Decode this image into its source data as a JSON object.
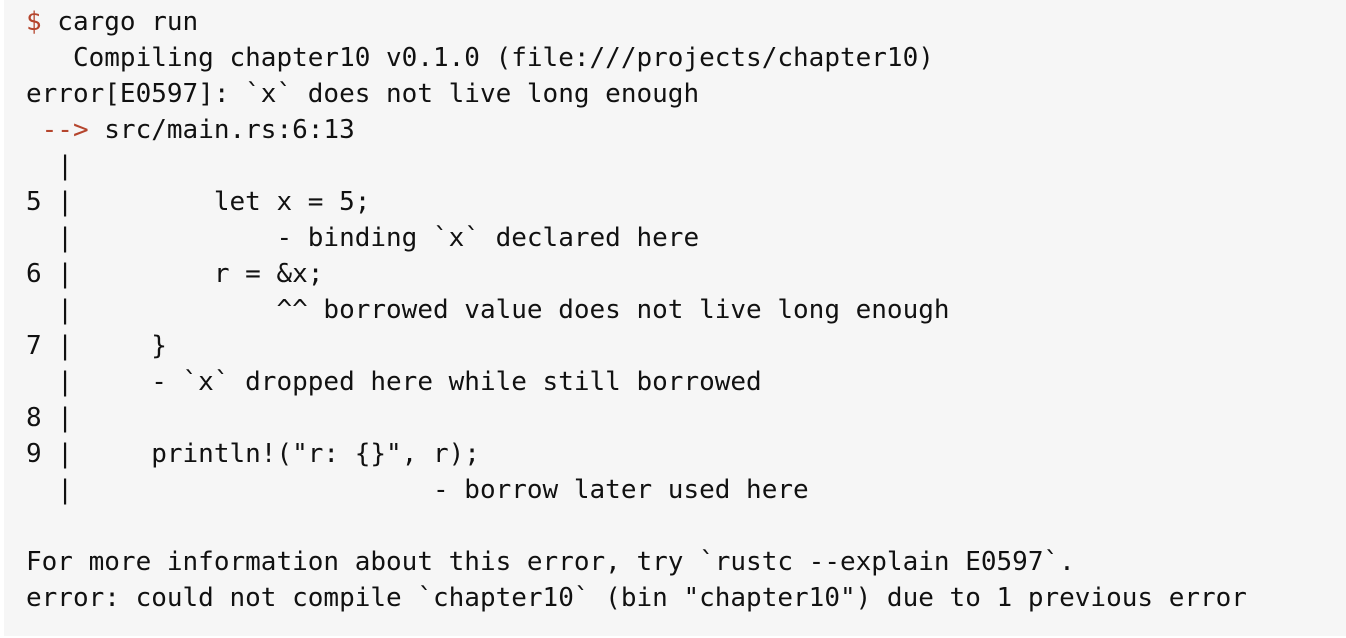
{
  "terminal": {
    "prompt_symbol": "$",
    "command": " cargo run",
    "lines": [
      "   Compiling chapter10 v0.1.0 (file:///projects/chapter10)",
      "error[E0597]: `x` does not live long enough",
      "",
      "  |",
      "5 |         let x = 5;",
      "  |             - binding `x` declared here",
      "6 |         r = &x;",
      "  |             ^^ borrowed value does not live long enough",
      "7 |     }",
      "  |     - `x` dropped here while still borrowed",
      "8 |",
      "9 |     println!(\"r: {}\", r);",
      "  |                       - borrow later used here",
      "",
      "For more information about this error, try `rustc --explain E0597`.",
      "error: could not compile `chapter10` (bin \"chapter10\") due to 1 previous error"
    ],
    "location_arrow": " -->",
    "location_path": " src/main.rs:6:13"
  },
  "colors": {
    "background": "#f6f6f6",
    "text": "#111111",
    "accent": "#b5452d"
  }
}
